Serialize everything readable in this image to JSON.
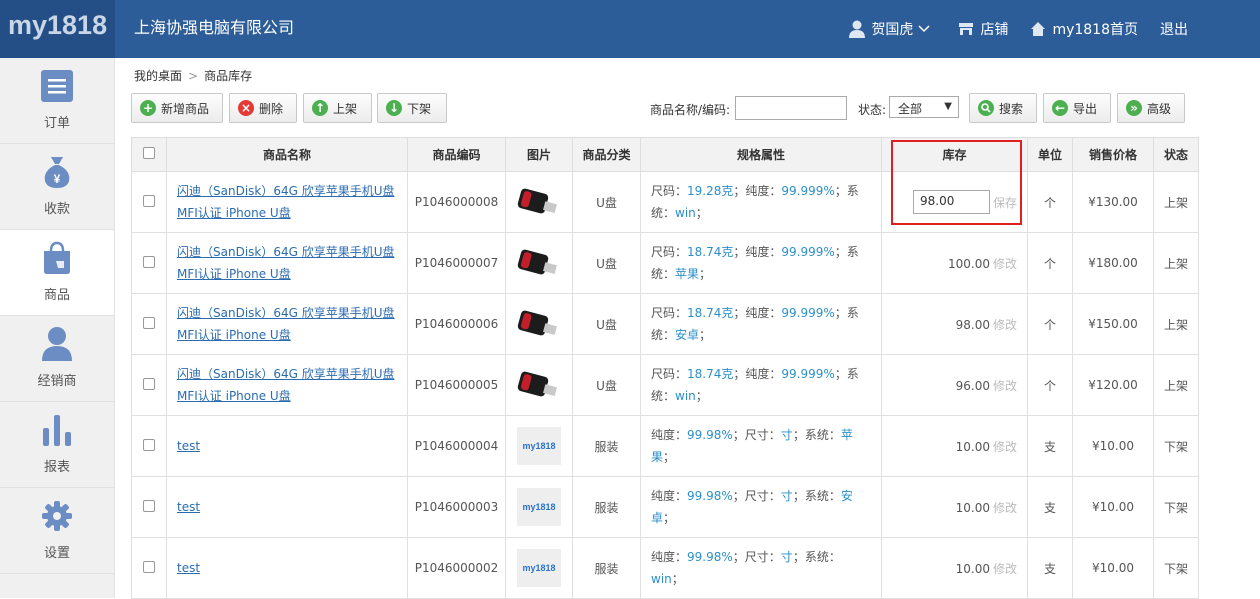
{
  "header": {
    "logo": "my1818",
    "company": "上海协强电脑有限公司",
    "user": "贺国虎",
    "shop": "店铺",
    "home": "my1818首页",
    "logout": "退出"
  },
  "sidebar": {
    "items": [
      {
        "label": "订单",
        "icon": "list-icon"
      },
      {
        "label": "收款",
        "icon": "money-bag-icon"
      },
      {
        "label": "商品",
        "icon": "shopping-bag-icon"
      },
      {
        "label": "经销商",
        "icon": "user-icon"
      },
      {
        "label": "报表",
        "icon": "bar-chart-icon"
      },
      {
        "label": "设置",
        "icon": "gear-icon"
      }
    ],
    "active": "商品"
  },
  "breadcrumb": {
    "home": "我的桌面",
    "sep": ">",
    "current": "商品库存"
  },
  "toolbar": {
    "add": "新增商品",
    "delete": "删除",
    "shelve": "上架",
    "unshelve": "下架",
    "name_label": "商品名称/编码:",
    "name_value": "",
    "status_label": "状态:",
    "status_value": "全部",
    "search": "搜索",
    "export": "导出",
    "advanced": "高级"
  },
  "table": {
    "headers": [
      "商品名称",
      "商品编码",
      "图片",
      "商品分类",
      "规格属性",
      "库存",
      "单位",
      "销售价格",
      "状态"
    ],
    "rows": [
      {
        "name": "闪迪（SanDisk）64G 欣享苹果手机U盘MFI认证 iPhone U盘",
        "code": "P1046000008",
        "image": "usb",
        "category": "U盘",
        "spec": [
          [
            "尺码：",
            "19.28克"
          ],
          [
            "；纯度：",
            "99.999%"
          ],
          [
            "；系统：",
            "win"
          ],
          [
            "；",
            ""
          ]
        ],
        "stock": "98.00",
        "stock_action": "保存",
        "unit": "个",
        "price": "¥130.00",
        "status": "上架"
      },
      {
        "name": "闪迪（SanDisk）64G 欣享苹果手机U盘MFI认证 iPhone U盘",
        "code": "P1046000007",
        "image": "usb",
        "category": "U盘",
        "spec": [
          [
            "尺码：",
            "18.74克"
          ],
          [
            "；纯度：",
            "99.999%"
          ],
          [
            "；系统：",
            "苹果"
          ],
          [
            "；",
            ""
          ]
        ],
        "stock": "100.00",
        "stock_action": "修改",
        "unit": "个",
        "price": "¥180.00",
        "status": "上架"
      },
      {
        "name": "闪迪（SanDisk）64G 欣享苹果手机U盘MFI认证 iPhone U盘",
        "code": "P1046000006",
        "image": "usb",
        "category": "U盘",
        "spec": [
          [
            "尺码：",
            "18.74克"
          ],
          [
            "；纯度：",
            "99.999%"
          ],
          [
            "；系统：",
            "安卓"
          ],
          [
            "；",
            ""
          ]
        ],
        "stock": "98.00",
        "stock_action": "修改",
        "unit": "个",
        "price": "¥150.00",
        "status": "上架"
      },
      {
        "name": "闪迪（SanDisk）64G 欣享苹果手机U盘MFI认证 iPhone U盘",
        "code": "P1046000005",
        "image": "usb",
        "category": "U盘",
        "spec": [
          [
            "尺码：",
            "18.74克"
          ],
          [
            "；纯度：",
            "99.999%"
          ],
          [
            "；系统：",
            "win"
          ],
          [
            "；",
            ""
          ]
        ],
        "stock": "96.00",
        "stock_action": "修改",
        "unit": "个",
        "price": "¥120.00",
        "status": "上架"
      },
      {
        "name": "test",
        "code": "P1046000004",
        "image": "logo",
        "category": "服装",
        "spec": [
          [
            "纯度：",
            "99.98%"
          ],
          [
            "；尺寸：",
            "寸"
          ],
          [
            "；系统：",
            "苹果"
          ],
          [
            "；",
            ""
          ]
        ],
        "stock": "10.00",
        "stock_action": "修改",
        "unit": "支",
        "price": "¥10.00",
        "status": "下架"
      },
      {
        "name": "test",
        "code": "P1046000003",
        "image": "logo",
        "category": "服装",
        "spec": [
          [
            "纯度：",
            "99.98%"
          ],
          [
            "；尺寸：",
            "寸"
          ],
          [
            "；系统：",
            "安卓"
          ],
          [
            "；",
            ""
          ]
        ],
        "stock": "10.00",
        "stock_action": "修改",
        "unit": "支",
        "price": "¥10.00",
        "status": "下架"
      },
      {
        "name": "test",
        "code": "P1046000002",
        "image": "logo",
        "category": "服装",
        "spec": [
          [
            "纯度：",
            "99.98%"
          ],
          [
            "；尺寸：",
            "寸"
          ],
          [
            "；系统：",
            "win"
          ],
          [
            "；",
            ""
          ]
        ],
        "stock": "10.00",
        "stock_action": "修改",
        "unit": "支",
        "price": "¥10.00",
        "status": "下架"
      }
    ],
    "logo_text": "my1818"
  },
  "colors": {
    "header": "#2d5d98",
    "link": "#2b6cb0",
    "spec_value": "#2b8fc9",
    "highlight": "#e02020"
  }
}
